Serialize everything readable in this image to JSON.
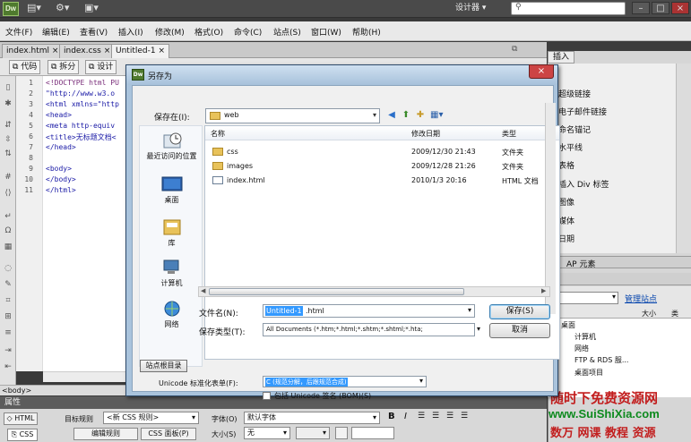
{
  "topbar": {
    "app_logo": "Dw",
    "designer": "设计器 ▾",
    "search_placeholder": "",
    "icons": [
      "layout-icon",
      "gear-icon",
      "site-icon"
    ]
  },
  "menubar": {
    "items": [
      "文件(F)",
      "编辑(E)",
      "查看(V)",
      "插入(I)",
      "修改(M)",
      "格式(O)",
      "命令(C)",
      "站点(S)",
      "窗口(W)",
      "帮助(H)"
    ]
  },
  "doctabs": [
    {
      "label": "index.html",
      "close": "×"
    },
    {
      "label": "index.css",
      "close": "×"
    },
    {
      "label": "Untitled-1",
      "close": "×"
    }
  ],
  "viewbar": {
    "code": "代码",
    "split": "拆分",
    "design": "设计"
  },
  "code": {
    "line_numbers": [
      "1",
      "2",
      "3",
      "4",
      "5",
      "6",
      "7",
      "8",
      "9",
      "10",
      "11"
    ],
    "lines": [
      "<!DOCTYPE html PU",
      "\"http://www.w3.o",
      "<html xmlns=\"http",
      "<head>",
      "<meta http-equiv",
      "<title>无标题文档<",
      "</head>",
      "",
      "<body>",
      "</body>",
      "</html>"
    ]
  },
  "statusbar": {
    "tag": "<body>"
  },
  "properties": {
    "header": "属性",
    "html_btn": "HTML",
    "css_btn": "CSS",
    "target_rule_label": "目标规则",
    "target_rule_value": "<新 CSS 规则>",
    "edit_rule": "编辑规则",
    "css_panel": "CSS 面板(P)",
    "font_label": "字体(O)",
    "font_value": "默认字体",
    "size_label": "大小(S)",
    "size_value": "无",
    "fmt": [
      "B",
      "I"
    ]
  },
  "right_panel": {
    "insert_tab": "插入",
    "insert_items": [
      "超级链接",
      "电子邮件链接",
      "命名锚记",
      "水平线",
      "表格",
      "插入 Div 标签",
      "图像",
      "媒体",
      "日期"
    ],
    "ap_tab": "AP 元素",
    "manage_sites": "管理站点",
    "files_cols": [
      "大小",
      "类"
    ],
    "files_rows": [
      "桌面",
      "计算机",
      "网络",
      "FTP & RDS 服...",
      "桌面项目"
    ]
  },
  "watermark": {
    "line1": "随时下免费资源网",
    "line2": "www.SuiShiXia.com",
    "line3": "数万 网课 教程 资源"
  },
  "dialog": {
    "title": "另存为",
    "save_in_label": "保存在(I):",
    "save_in_value": "web",
    "places": [
      "最近访问的位置",
      "桌面",
      "库",
      "计算机",
      "网络"
    ],
    "columns": [
      "名称",
      "修改日期",
      "类型"
    ],
    "files": [
      {
        "name": "css",
        "date": "2009/12/30 21:43",
        "type": "文件夹",
        "icon": "folder-icon"
      },
      {
        "name": "images",
        "date": "2009/12/28 21:26",
        "type": "文件夹",
        "icon": "folder-icon"
      },
      {
        "name": "index.html",
        "date": "2010/1/3 20:16",
        "type": "HTML 文档",
        "icon": "html-file-icon"
      }
    ],
    "filename_label": "文件名(N):",
    "filename_selected": "Untitled-1",
    "filename_rest": ".html",
    "filetype_label": "保存类型(T):",
    "filetype_value": "All Documents (*.htm;*.html;*.shtm;*.shtml;*.hta;",
    "save_button": "保存(S)",
    "cancel_button": "取消",
    "site_root_button": "站点根目录",
    "unicode_label": "Unicode 标准化表单(F):",
    "unicode_value": "C (规范分解，后跟规范合成)",
    "bom_label": "包括 Unicode 签名 (BOM)(S)"
  }
}
